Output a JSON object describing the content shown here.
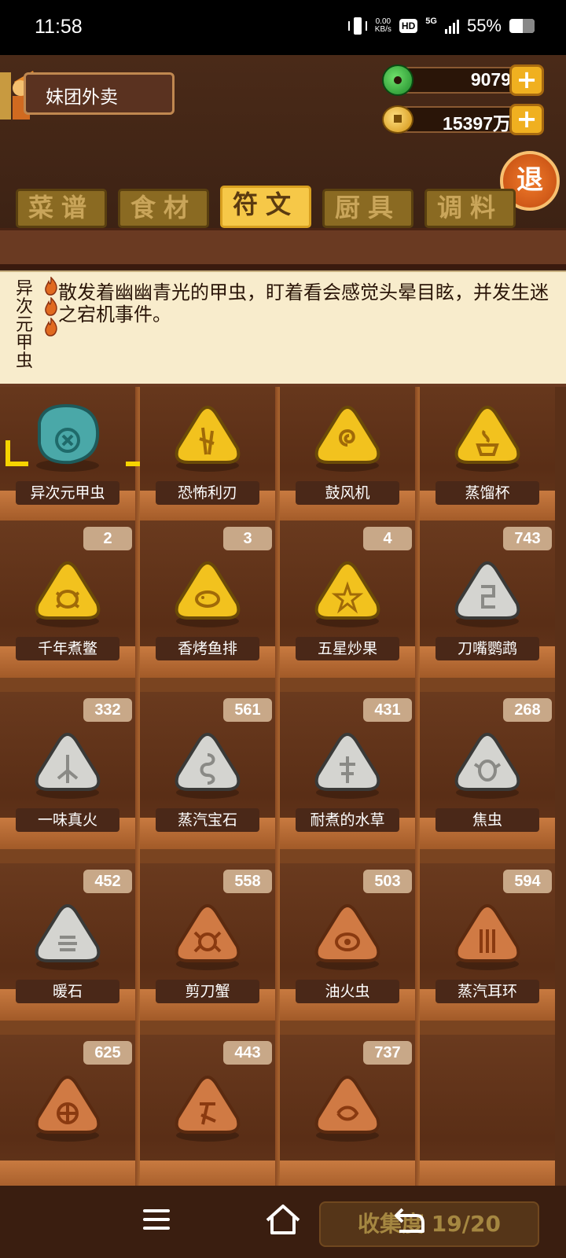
{
  "status_bar": {
    "time": "11:58",
    "net_speed_value": "0.00",
    "net_speed_unit": "KB/s",
    "hd": "HD",
    "network": "5G",
    "battery": "55%"
  },
  "header": {
    "shop_name": "妹团外卖",
    "jade_amount": "9079",
    "coin_amount": "15397万",
    "plus_label": "+",
    "exit_label": "退"
  },
  "tabs": [
    {
      "label": "菜谱",
      "active": false
    },
    {
      "label": "食材",
      "active": false
    },
    {
      "label": "符文",
      "active": true
    },
    {
      "label": "厨具",
      "active": false
    },
    {
      "label": "调料",
      "active": false
    }
  ],
  "description": {
    "item_name": "异次元甲虫",
    "text": "散发着幽幽青光的甲虫，盯着看会感觉头晕目眩，并发生迷之宕机事件。"
  },
  "runes": [
    {
      "name": "异次元甲虫",
      "count": "",
      "color": "teal",
      "icon": "beetle-rune-icon"
    },
    {
      "name": "恐怖利刃",
      "count": "",
      "color": "gold",
      "icon": "blade-rune-icon"
    },
    {
      "name": "鼓风机",
      "count": "",
      "color": "gold",
      "icon": "spiral-rune-icon"
    },
    {
      "name": "蒸馏杯",
      "count": "",
      "color": "gold",
      "icon": "cup-rune-icon"
    },
    {
      "name": "千年煮鳖",
      "count": "2",
      "color": "gold",
      "icon": "turtle-rune-icon"
    },
    {
      "name": "香烤鱼排",
      "count": "3",
      "color": "gold",
      "icon": "fish-rune-icon"
    },
    {
      "name": "五星炒果",
      "count": "4",
      "color": "gold",
      "icon": "star-rune-icon"
    },
    {
      "name": "刀嘴鹦鹉",
      "count": "743",
      "color": "silver",
      "icon": "parrot-rune-icon"
    },
    {
      "name": "一味真火",
      "count": "332",
      "color": "silver",
      "icon": "fire-rune-icon"
    },
    {
      "name": "蒸汽宝石",
      "count": "561",
      "color": "silver",
      "icon": "gem-rune-icon"
    },
    {
      "name": "耐煮的水草",
      "count": "431",
      "color": "silver",
      "icon": "weed-rune-icon"
    },
    {
      "name": "焦虫",
      "count": "268",
      "color": "silver",
      "icon": "bug-rune-icon"
    },
    {
      "name": "暖石",
      "count": "452",
      "color": "silver",
      "icon": "stone-rune-icon"
    },
    {
      "name": "剪刀蟹",
      "count": "558",
      "color": "bronze",
      "icon": "crab-rune-icon"
    },
    {
      "name": "油火虫",
      "count": "503",
      "color": "bronze",
      "icon": "firefly-rune-icon"
    },
    {
      "name": "蒸汽耳环",
      "count": "594",
      "color": "bronze",
      "icon": "earring-rune-icon"
    },
    {
      "name": "",
      "count": "625",
      "color": "bronze",
      "icon": "wheel-rune-icon"
    },
    {
      "name": "",
      "count": "443",
      "color": "bronze",
      "icon": "glyph-rune-icon"
    },
    {
      "name": "",
      "count": "737",
      "color": "bronze",
      "icon": "wave-rune-icon"
    }
  ],
  "collection": {
    "label": "收集度 19/20"
  },
  "colors": {
    "teal": "#4aa8a8",
    "gold": "#f2c21e",
    "silver": "#d4d4d0",
    "bronze": "#d07a44",
    "active_tab": "#f6c848"
  }
}
